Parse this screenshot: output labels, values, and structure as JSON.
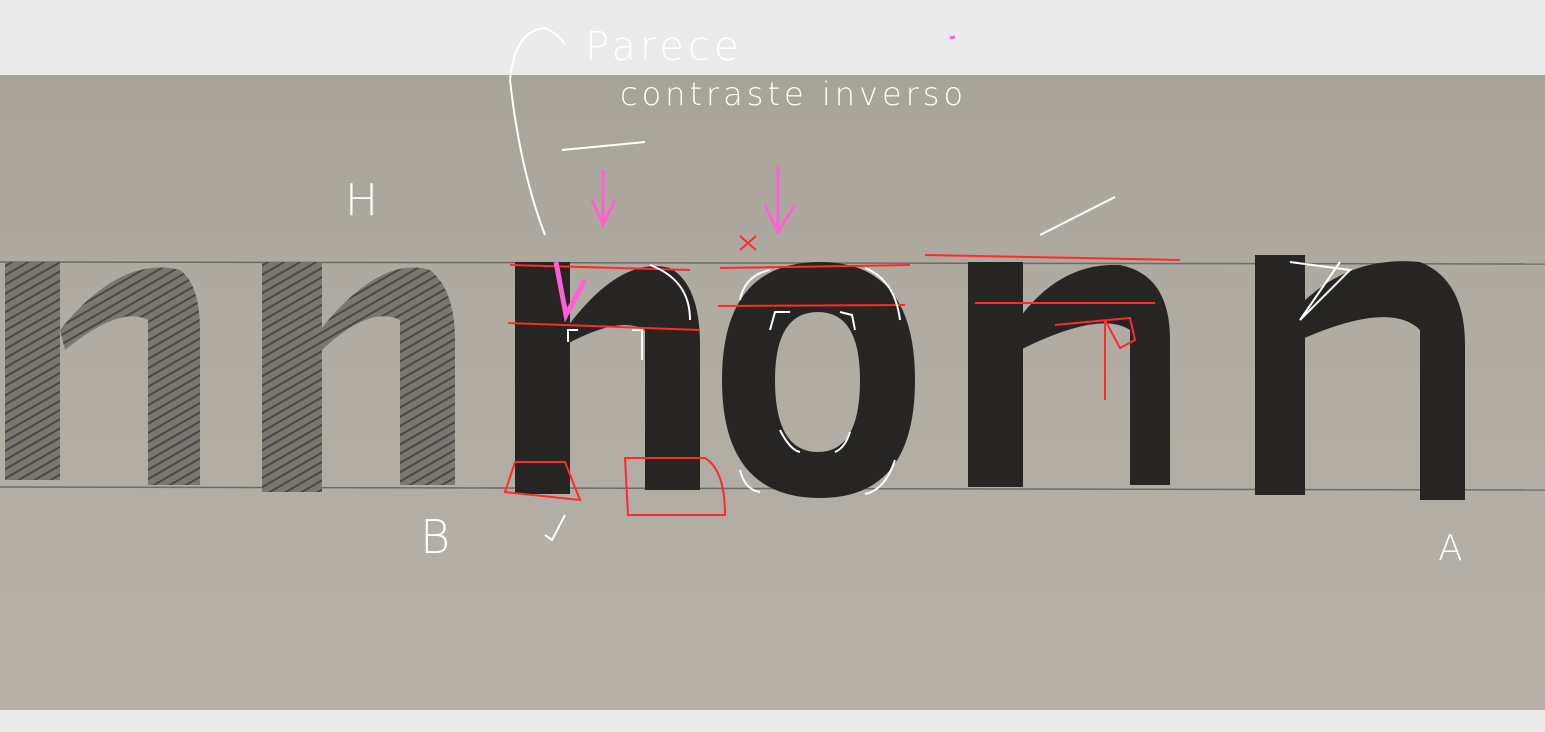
{
  "annotations": {
    "top_note_line1": "Parece",
    "top_note_line2": "contraste inverso",
    "label_h": "H",
    "label_b": "B",
    "label_a": "A"
  },
  "colors": {
    "canvas_background": "#ebebeb",
    "paper": "#aca79e",
    "pencil_dark": "#1e1e1e",
    "pencil_light": "#5a5854",
    "annotation_white": "#ffffff",
    "annotation_red": "#ff2a2a",
    "annotation_pink": "#ff5fd2"
  }
}
